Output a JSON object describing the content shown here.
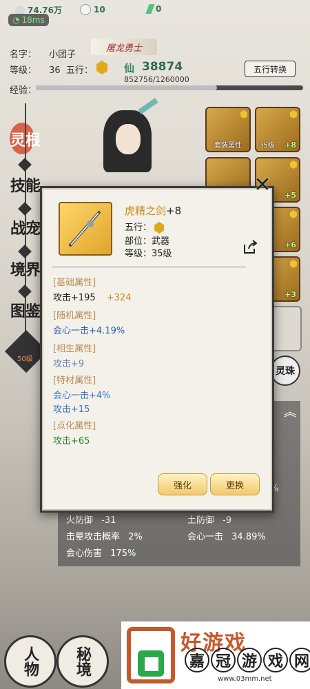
{
  "topbar": {
    "currency1": "74.76万",
    "currency2": "10",
    "currency3": "0",
    "latency": "18ms"
  },
  "character": {
    "name_label": "名字：",
    "name": "小团子",
    "title": "屠龙勇士",
    "level_label": "等级：",
    "level": "36",
    "wuxing_label": "五行：",
    "xian_label": "仙",
    "power": "38874",
    "exp_text": "852756/1260000",
    "exp_label": "经验：",
    "exp_fraction": 0.6767,
    "switch_button": "五行转换"
  },
  "side_menu": [
    {
      "label": "灵根",
      "active": true
    },
    {
      "label": "技能",
      "active": false
    },
    {
      "label": "战宠",
      "active": false
    },
    {
      "label": "境界",
      "active": false
    },
    {
      "label": "图鉴",
      "active": false
    }
  ],
  "side_badge": "50级",
  "equipment": {
    "slot1_label": "套装属性",
    "slot2_level": "35级",
    "slot2_plus": "+8",
    "slot4_plus": "+5",
    "slot6_plus": "+6",
    "slot8_plus": "+3"
  },
  "spirit_label": "灵珠",
  "stats": {
    "fire_defense_label": "火防御",
    "fire_defense": "-31",
    "earth_defense_label": "土防御",
    "earth_defense": "-9",
    "stun_label": "击晕攻击概率",
    "stun": "2%",
    "crit_label": "会心一击",
    "crit": "34.89%",
    "crit_dmg_label": "会心伤害",
    "crit_dmg": "175%",
    "partial": "%"
  },
  "bottom_nav": [
    {
      "label": "人物"
    },
    {
      "label": "秘境"
    }
  ],
  "watermark": {
    "top_text": "好游戏",
    "chars": [
      "嘉",
      "冠",
      "游",
      "戏",
      "网"
    ],
    "url": "www.03mm.net"
  },
  "item": {
    "name": "虎精之剑",
    "plus": "+8",
    "wuxing_label": "五行：",
    "part": "部位：武器",
    "level": "等级：35级",
    "close": "✕",
    "sections": {
      "base_title": "[基础属性]",
      "base_attack": "攻击+195",
      "base_bonus": "+324",
      "random_title": "[随机属性]",
      "random_crit": "会心一击+4.19%",
      "mutual_title": "[相生属性]",
      "mutual_attack": "攻击+9",
      "special_title": "[特材属性]",
      "special_crit": "会心一击+4%",
      "special_attack": "攻击+15",
      "refine_title": "[点化属性]",
      "refine_attack": "攻击+65"
    },
    "buttons": {
      "enhance": "强化",
      "replace": "更换"
    }
  },
  "colors": {
    "gold": "#c98a12",
    "blue": "#2b5fa8",
    "lightblue": "#3a77c4",
    "green": "#2f7d2f",
    "section_title": "#b98a4e"
  }
}
